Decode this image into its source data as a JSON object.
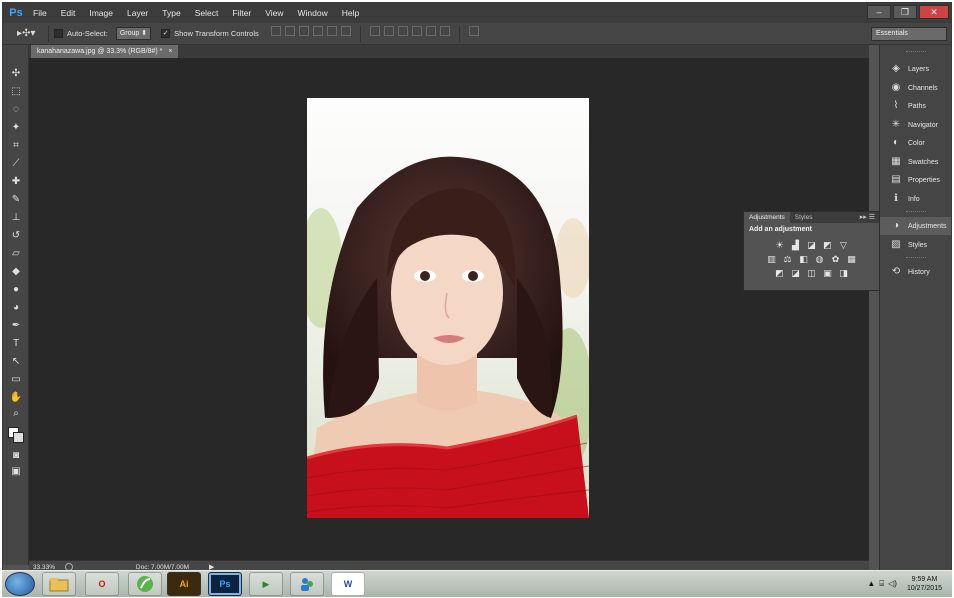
{
  "app": {
    "logo": "Ps"
  },
  "menu": [
    "File",
    "Edit",
    "Image",
    "Layer",
    "Type",
    "Select",
    "Filter",
    "View",
    "Window",
    "Help"
  ],
  "window_controls": {
    "minimize": "–",
    "restore": "❐",
    "close": "✕"
  },
  "options": {
    "auto_select_label": "Auto-Select:",
    "auto_select_value": "Group",
    "show_transform_label": "Show Transform Controls",
    "workspace": "Essentials"
  },
  "document": {
    "tab": "kanahanazawa.jpg @ 33.3% (RGB/8#) *",
    "close": "×"
  },
  "status": {
    "zoom": "33.33%",
    "doc": "Doc: 7.00M/7.00M",
    "arrow": "▶"
  },
  "dock": [
    {
      "label": "Layers",
      "icon": "◈"
    },
    {
      "label": "Channels",
      "icon": "◉"
    },
    {
      "label": "Paths",
      "icon": "⌇"
    },
    {
      "label": "Navigator",
      "icon": "✳"
    },
    {
      "label": "Color",
      "icon": "◐"
    },
    {
      "label": "Swatches",
      "icon": "▦"
    },
    {
      "label": "Properties",
      "icon": "▤"
    },
    {
      "label": "Info",
      "icon": "ℹ"
    },
    {
      "label": "Adjustments",
      "icon": "◑"
    },
    {
      "label": "Styles",
      "icon": "▨"
    },
    {
      "label": "History",
      "icon": "⟲"
    }
  ],
  "adjustments": {
    "tab_active": "Adjustments",
    "tab_other": "Styles",
    "title": "Add an adjustment",
    "menu": "▸▸ ☰",
    "row1": [
      "☀",
      "▟",
      "◪",
      "◩",
      "▽"
    ],
    "row2": [
      "▥",
      "⚖",
      "◧",
      "◍",
      "✿",
      "▦"
    ],
    "row3": [
      "◩",
      "◪",
      "◫",
      "▣",
      "◨"
    ]
  },
  "taskbar": {
    "apps": [
      "",
      "O",
      "",
      "Ai",
      "Ps",
      "▶",
      "",
      "W"
    ],
    "time": "9:59 AM",
    "date": "10/27/2015",
    "tray_arrow": "▲"
  }
}
